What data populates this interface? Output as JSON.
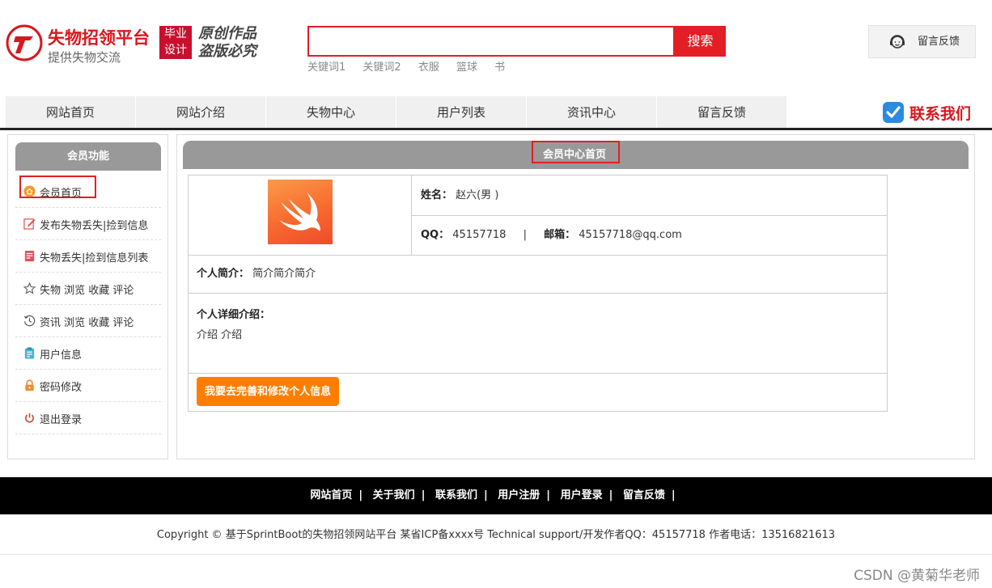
{
  "header": {
    "logo_title": "失物招领平台",
    "logo_subtitle": "提供失物交流",
    "badge_line1": "毕业",
    "badge_line2": "设计",
    "slogan_line1": "原创作品",
    "slogan_line2": "盗版必究",
    "search": {
      "value": "",
      "placeholder": "",
      "button_label": "搜索"
    },
    "keywords": [
      "关键词1",
      "关键词2",
      "衣服",
      "篮球",
      "书"
    ],
    "feedback_label": "留言反馈"
  },
  "nav": {
    "items": [
      "网站首页",
      "网站介绍",
      "失物中心",
      "用户列表",
      "资讯中心",
      "留言反馈"
    ],
    "contact_label": "联系我们"
  },
  "sidebar": {
    "title": "会员功能",
    "items": [
      {
        "label": "会员首页",
        "icon": "home-circle-icon"
      },
      {
        "label": "发布失物丢失|捡到信息",
        "icon": "edit-icon"
      },
      {
        "label": "失物丢失|捡到信息列表",
        "icon": "list-icon"
      },
      {
        "label": "失物 浏览 收藏 评论",
        "icon": "star-icon"
      },
      {
        "label": "资讯 浏览 收藏 评论",
        "icon": "history-icon"
      },
      {
        "label": "用户信息",
        "icon": "clipboard-icon"
      },
      {
        "label": "密码修改",
        "icon": "lock-icon"
      },
      {
        "label": "退出登录",
        "icon": "power-icon"
      }
    ]
  },
  "main": {
    "title": "会员中心首页",
    "profile": {
      "name_label": "姓名：",
      "name_value": "赵六(男 )",
      "qq_label": "QQ：",
      "qq_value": "45157718",
      "divider": "|",
      "email_label": "邮箱：",
      "email_value": "45157718@qq.com",
      "intro_label": "个人简介：",
      "intro_value": "简介简介简介",
      "detail_label": "个人详细介绍：",
      "detail_value": "介绍 介绍",
      "edit_button": "我要去完善和修改个人信息"
    }
  },
  "footer": {
    "links": [
      "网站首页",
      "关于我们",
      "联系我们",
      "用户注册",
      "用户登录",
      "留言反馈"
    ],
    "copyright": "Copyright © 基于SprintBoot的失物招领网站平台    某省ICP备xxxx号    Technical support/开发作者QQ：45157718    作者电话：13516821613",
    "watermark": "CSDN @黄菊华老师"
  },
  "colors": {
    "brand_red": "#e31e24",
    "header_gray": "#999999",
    "button_orange": "#ff7e00",
    "footer_black": "#000000"
  }
}
